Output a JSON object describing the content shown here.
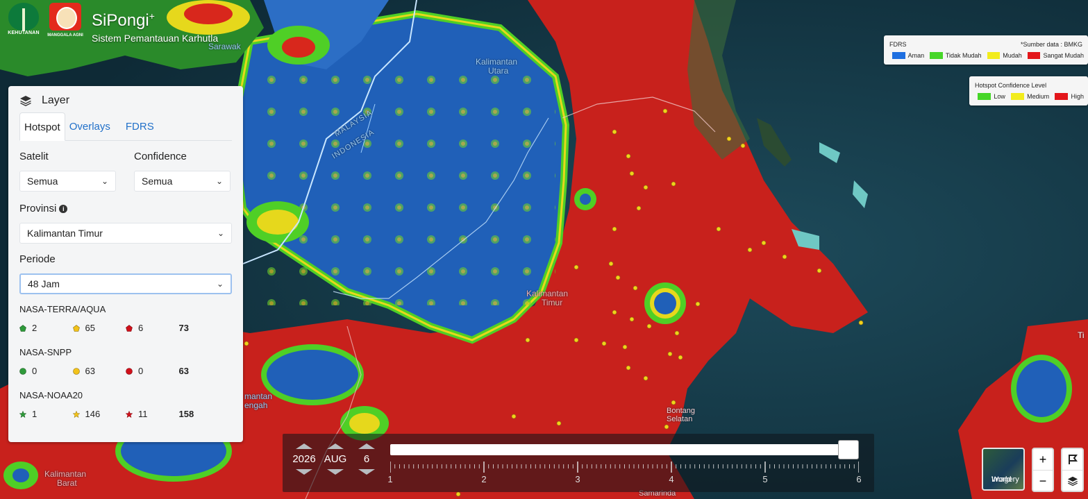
{
  "header": {
    "logo_left_text": "KEHUTANAN",
    "logo_right_text": "MANGGALA AGNI",
    "app_title": "SiPongi",
    "app_title_sup": "+",
    "app_subtitle": "Sistem Pemantauan Karhutla"
  },
  "layer_panel": {
    "title": "Layer",
    "tabs": [
      "Hotspot",
      "Overlays",
      "FDRS"
    ],
    "active_tab": "Hotspot",
    "satelit_label": "Satelit",
    "satelit_value": "Semua",
    "confidence_label": "Confidence",
    "confidence_value": "Semua",
    "provinsi_label": "Provinsi",
    "provinsi_value": "Kalimantan Timur",
    "periode_label": "Periode",
    "periode_value": "48 Jam",
    "satellites": [
      {
        "name": "NASA-TERRA/AQUA",
        "shape": "pentagon",
        "low": "2",
        "medium": "65",
        "high": "6",
        "total": "73"
      },
      {
        "name": "NASA-SNPP",
        "shape": "circle",
        "low": "0",
        "medium": "63",
        "high": "0",
        "total": "63"
      },
      {
        "name": "NASA-NOAA20",
        "shape": "star",
        "low": "1",
        "medium": "146",
        "high": "11",
        "total": "158"
      }
    ]
  },
  "fdrs_legend": {
    "title": "FDRS",
    "source": "*Sumber data : BMKG",
    "items": [
      {
        "label": "Aman",
        "color": "#1f6fe0"
      },
      {
        "label": "Tidak Mudah",
        "color": "#46d628"
      },
      {
        "label": "Mudah",
        "color": "#f2ec1c"
      },
      {
        "label": "Sangat Mudah",
        "color": "#e3161a"
      }
    ]
  },
  "confidence_legend": {
    "title": "Hotspot Confidence Level",
    "items": [
      {
        "label": "Low",
        "color": "#46d628"
      },
      {
        "label": "Medium",
        "color": "#f2ec1c"
      },
      {
        "label": "High",
        "color": "#e3161a"
      }
    ]
  },
  "time_slider": {
    "year": "2026",
    "month": "AUG",
    "day": "6",
    "tick_labels": [
      "1",
      "2",
      "3",
      "4",
      "5",
      "6"
    ],
    "position_fraction": 1.0
  },
  "map_labels": {
    "sarawak": "Sarawak",
    "kalimantan_utara_1": "Kalimantan",
    "kalimantan_utara_2": "Utara",
    "malaysia": "MALAYSIA",
    "indonesia": "INDONESIA",
    "kalimantan_timur_1": "Kalimantan",
    "kalimantan_timur_2": "Timur",
    "kalimantan_tengah_1": "mantan",
    "kalimantan_tengah_2": "engah",
    "kalimantan_barat_1": "Kalimantan",
    "kalimantan_barat_2": "Barat",
    "bontang_1": "Bontang",
    "bontang_2": "Selatan",
    "samarinda": "Samarinda",
    "edge_label": "Ti"
  },
  "controls": {
    "basemap_label_1": "World",
    "basemap_label_2": "Imagery",
    "zoom_in": "+",
    "zoom_out": "−"
  },
  "colors": {
    "aman": "#1f6fe0",
    "tidak_mudah": "#46d628",
    "mudah": "#f2ec1c",
    "sangat_mudah": "#e3161a",
    "tab_link": "#2170c9"
  }
}
